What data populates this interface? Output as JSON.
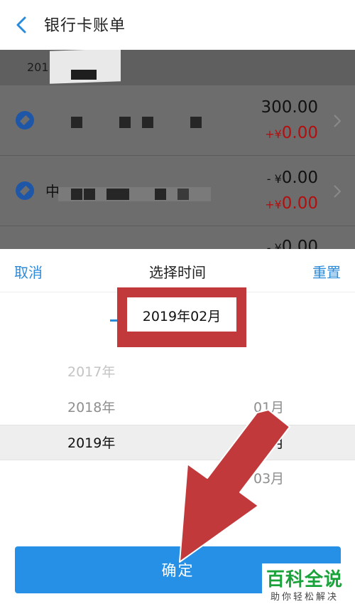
{
  "header": {
    "back_icon": "chevron-left-icon",
    "title": "银行卡账单"
  },
  "list": {
    "period_prefix": "201",
    "rows": [
      {
        "name_fragment": "",
        "amount_main": "300.00",
        "amount_main_prefix": "",
        "amount_sub_prefix": "+¥",
        "amount_sub": "0.00"
      },
      {
        "name_fragment": "中",
        "amount_main": "0.00",
        "amount_main_prefix": "- ¥",
        "amount_sub_prefix": "+¥",
        "amount_sub": "0.00"
      },
      {
        "name_fragment": "",
        "amount_main": "0.00",
        "amount_main_prefix": "- ¥",
        "amount_sub_prefix": "",
        "amount_sub": ""
      }
    ]
  },
  "picker": {
    "cancel_label": "取消",
    "title": "选择时间",
    "reset_label": "重置",
    "selected_display": "2019年02月",
    "years": [
      "2017年",
      "2018年",
      "2019年"
    ],
    "months": [
      "01月",
      "02月",
      "03月"
    ],
    "confirm_label": "确定"
  },
  "colors": {
    "accent": "#2b8bdb",
    "button": "#2590e6",
    "annotation": "#c2393b",
    "negative": "#b30f0f"
  },
  "watermark": {
    "title": "百科全说",
    "subtitle": "助你轻松解决"
  }
}
